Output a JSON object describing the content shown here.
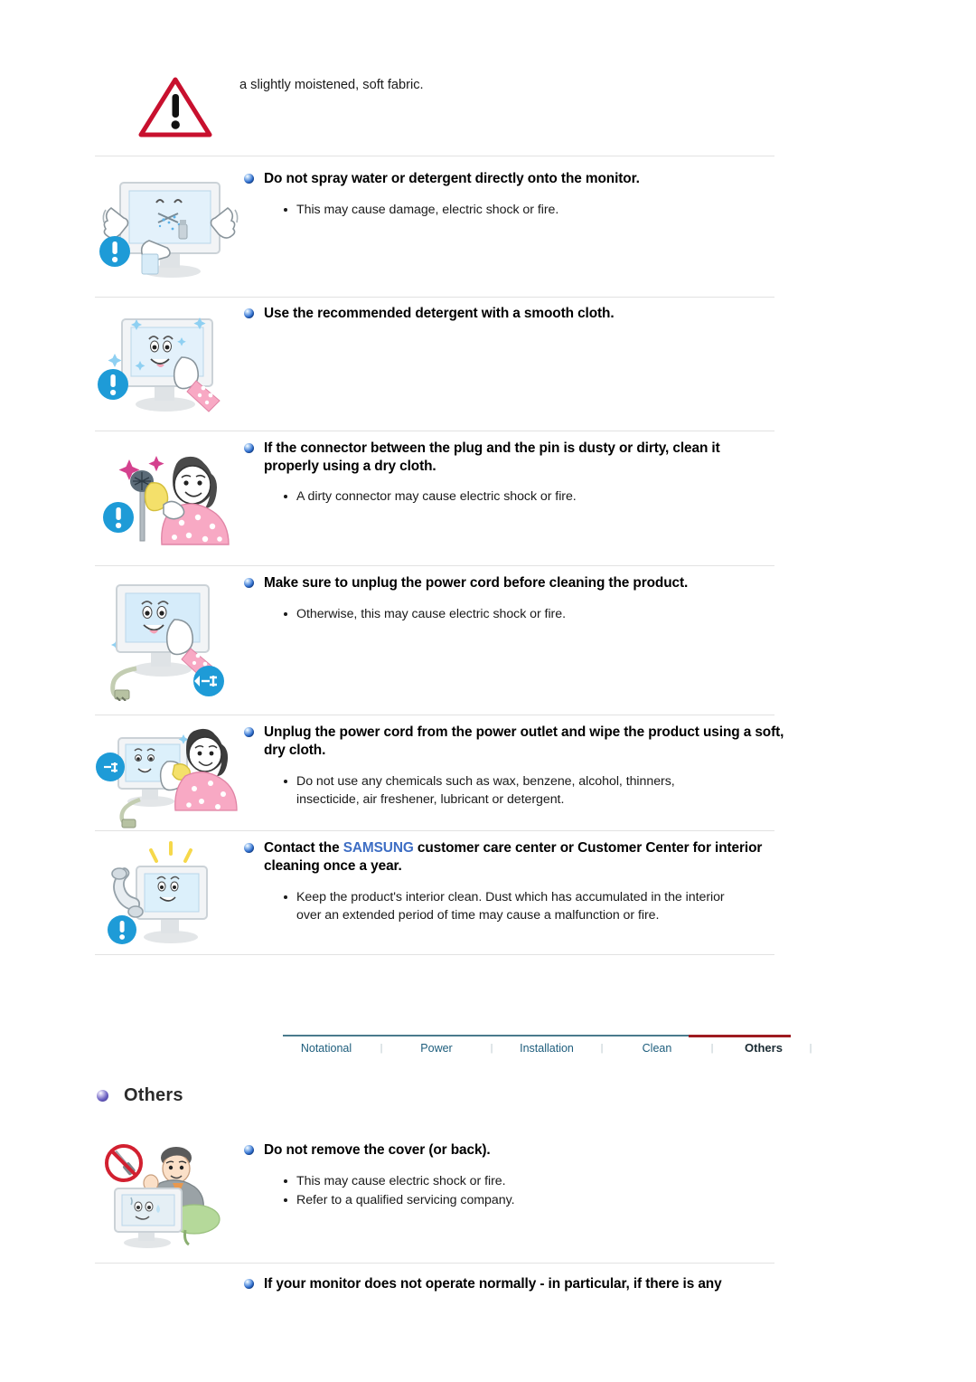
{
  "document": {
    "top_text": "a slightly moistened, soft fabric.",
    "warning_icon": "warning-triangle-icon"
  },
  "sections": [
    {
      "id": "spray",
      "illustration": "monitor-spray-bottle-hands-illustration",
      "badge": "blue-exclamation-badge",
      "heading": "Do not spray water or detergent directly onto the monitor.",
      "bullets": [
        "This may cause damage, electric shock or fire."
      ]
    },
    {
      "id": "detergent",
      "illustration": "monitor-wipe-cloth-illustration",
      "badge": "blue-exclamation-badge",
      "heading": "Use the recommended detergent with a smooth cloth.",
      "bullets": []
    },
    {
      "id": "connector",
      "illustration": "woman-cleaning-plug-illustration",
      "badge": "blue-exclamation-badge",
      "heading": "If the connector between the plug and the pin is dusty or dirty, clean it properly using a dry cloth.",
      "bullets": [
        "A dirty connector may cause electric shock or fire."
      ]
    },
    {
      "id": "unplug-before-clean",
      "illustration": "monitor-unplug-cable-illustration",
      "badge": "blue-unplug-badge",
      "heading": "Make sure to unplug the power cord before cleaning the product.",
      "bullets": [
        "Otherwise, this may cause electric shock or fire."
      ]
    },
    {
      "id": "wipe-dry-cloth",
      "illustration": "woman-wiping-monitor-illustration",
      "badge": "blue-unplug-badge",
      "heading": "Unplug the power cord from the power outlet and wipe the product using a soft, dry cloth.",
      "bullets": [
        "Do not use any chemicals such as wax, benzene, alcohol, thinners, insecticide, air freshener, lubricant or detergent."
      ]
    },
    {
      "id": "samsung-contact",
      "illustration": "phone-call-monitor-illustration",
      "badge": "blue-exclamation-badge",
      "heading_pre": "Contact the ",
      "heading_brand": "SAMSUNG",
      "heading_post": " customer care center or Customer Center for interior cleaning once a year.",
      "bullets": [
        "Keep the product's interior clean. Dust which has accumulated in the interior over an extended period of time may cause a malfunction or fire."
      ]
    }
  ],
  "tabs": {
    "items": [
      {
        "label": "Notational",
        "active": false
      },
      {
        "label": "Power",
        "active": false
      },
      {
        "label": "Installation",
        "active": false
      },
      {
        "label": "Clean",
        "active": false
      },
      {
        "label": "Others",
        "active": true
      }
    ],
    "separator": "|",
    "accent_active": "#9e1b20",
    "accent_line": "#4a7b8c",
    "link_color": "#1d5d7c"
  },
  "others_section": {
    "title": "Others",
    "items": [
      {
        "id": "do-not-remove-cover",
        "illustration": "no-screwdriver-technician-illustration",
        "heading": "Do not remove the cover (or back).",
        "bullets": [
          "This may cause electric shock or fire.",
          "Refer to a qualified servicing company."
        ]
      },
      {
        "id": "abnormal-operation",
        "heading": "If your monitor does not operate normally - in particular, if there is any",
        "bullets": []
      }
    ]
  },
  "colors": {
    "samsung_blue": "#3e6ec4",
    "warning_red": "#c8102e",
    "badge_blue": "#1e9bd7",
    "divider": "#e2e2e2"
  }
}
